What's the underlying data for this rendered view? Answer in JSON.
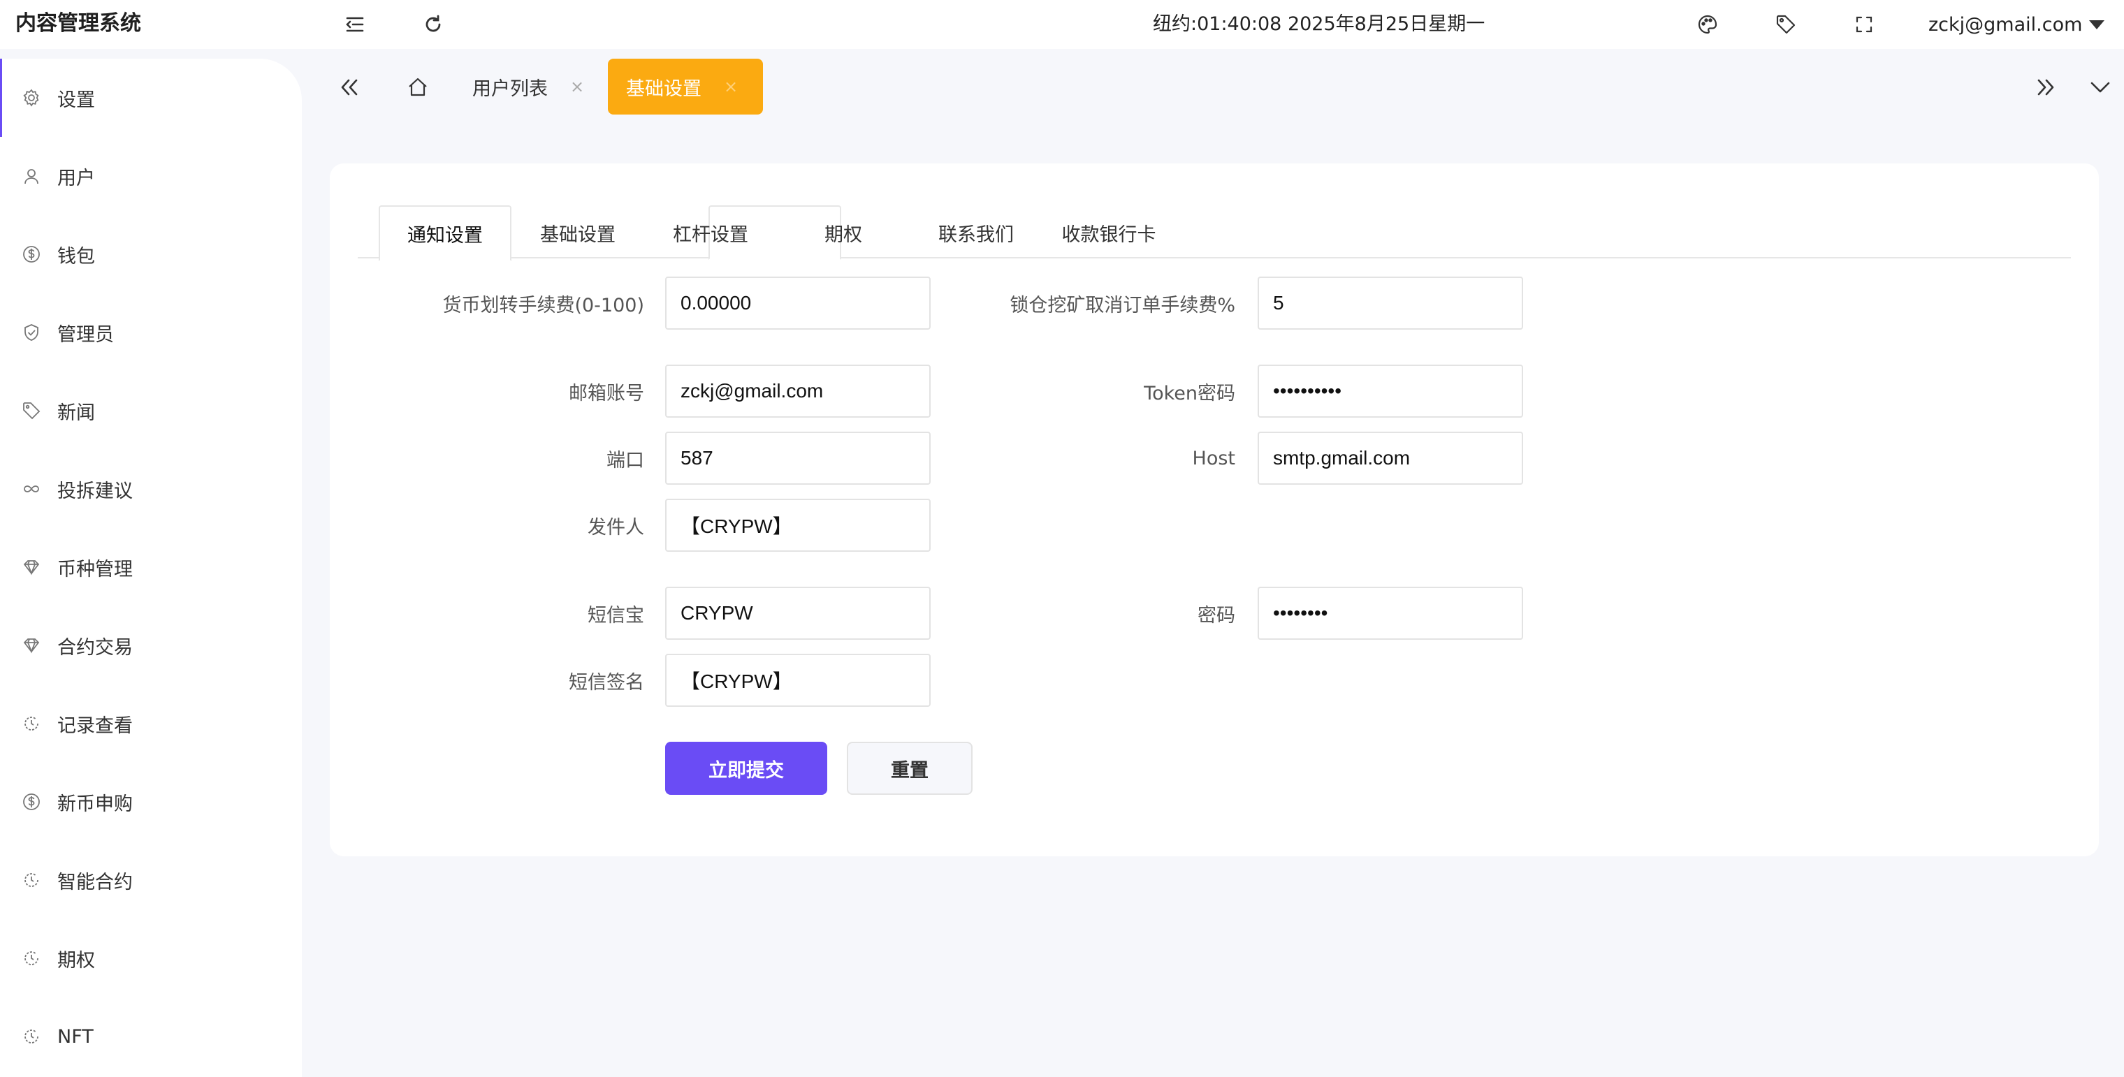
{
  "app": {
    "title": "内容管理系统"
  },
  "topbar": {
    "clock": "纽约:01:40:08 2025年8月25日星期一",
    "user_email": "zckj@gmail.com"
  },
  "sidebar": {
    "items": [
      {
        "label": "设置",
        "icon": "gear-icon"
      },
      {
        "label": "用户",
        "icon": "user-icon"
      },
      {
        "label": "钱包",
        "icon": "dollar-icon"
      },
      {
        "label": "管理员",
        "icon": "shield-icon"
      },
      {
        "label": "新闻",
        "icon": "tag-icon"
      },
      {
        "label": "投拆建议",
        "icon": "infinity-icon"
      },
      {
        "label": "币种管理",
        "icon": "diamond-icon"
      },
      {
        "label": "合约交易",
        "icon": "diamond-icon"
      },
      {
        "label": "记录查看",
        "icon": "cycle-icon"
      },
      {
        "label": "新币申购",
        "icon": "dollar-icon"
      },
      {
        "label": "智能合约",
        "icon": "cycle-icon"
      },
      {
        "label": "期权",
        "icon": "cycle-icon"
      },
      {
        "label": "NFT",
        "icon": "cycle-icon"
      }
    ]
  },
  "page_tabs": [
    {
      "label": "用户列表",
      "close": "×"
    },
    {
      "label": "基础设置",
      "close": "×"
    }
  ],
  "form_tabs": [
    "通知设置",
    "基础设置",
    "杠杆设置",
    "期权",
    "联系我们",
    "收款银行卡"
  ],
  "form": {
    "transfer_fee_label": "货币划转手续费(0-100)",
    "transfer_fee_value": "0.00000",
    "lock_mining_fee_label": "锁仓挖矿取消订单手续费%",
    "lock_mining_fee_value": "5",
    "email_label": "邮箱账号",
    "email_value": "zckj@gmail.com",
    "token_label": "Token密码",
    "token_value": "••••••••••",
    "port_label": "端口",
    "port_value": "587",
    "host_label": "Host",
    "host_value": "smtp.gmail.com",
    "sender_label": "发件人",
    "sender_value": "【CRYPW】",
    "sms_label": "短信宝",
    "sms_value": "CRYPW",
    "sms_password_label": "密码",
    "sms_password_value": "••••••••",
    "sms_sign_label": "短信签名",
    "sms_sign_value": "【CRYPW】",
    "submit_label": "立即提交",
    "reset_label": "重置"
  },
  "colors": {
    "accent": "#6a4cf5",
    "active_tab": "#fbaa11",
    "background": "#f6f7fb"
  }
}
